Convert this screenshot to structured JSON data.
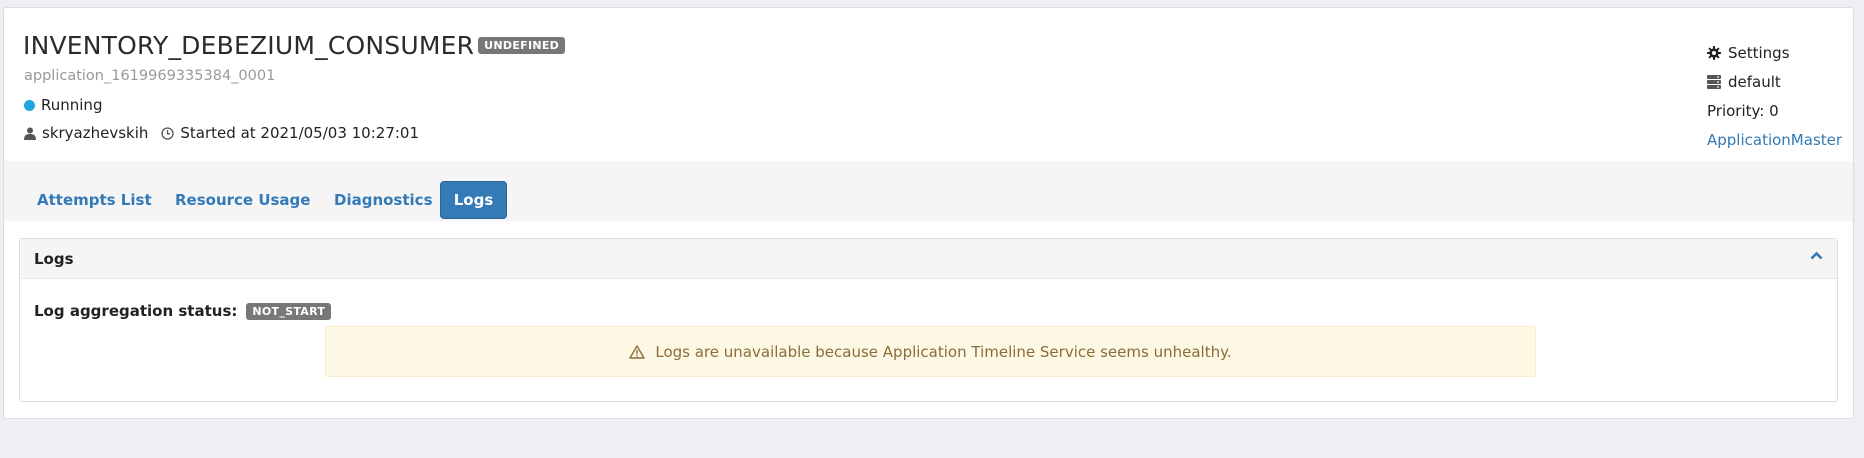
{
  "app": {
    "name": "INVENTORY_DEBEZIUM_CONSUMER",
    "final_status": "UNDEFINED",
    "id": "application_1619969335384_0001",
    "state": "Running",
    "state_color": "#1ea6dd",
    "user": "skryazhevskih",
    "started": "Started at 2021/05/03 10:27:01"
  },
  "sidebar_info": {
    "settings_label": "Settings",
    "queue": "default",
    "priority": "Priority: 0",
    "am_link": "ApplicationMaster"
  },
  "tabs": [
    {
      "label": "Attempts List",
      "active": false
    },
    {
      "label": "Resource Usage",
      "active": false
    },
    {
      "label": "Diagnostics",
      "active": false
    },
    {
      "label": "Logs",
      "active": true
    }
  ],
  "logs": {
    "heading": "Logs",
    "aggregation_label": "Log aggregation status:",
    "aggregation_status": "NOT_START",
    "alert_text": "Logs are unavailable because Application Timeline Service seems unhealthy."
  },
  "icons": {
    "settings": "gear-icon",
    "queue": "server-icon",
    "user": "user-icon",
    "clock": "clock-icon",
    "warning": "warning-icon",
    "collapse": "chevron-up-icon"
  },
  "colors": {
    "accent": "#337ab7",
    "alert_bg": "#fcf8e3",
    "alert_text": "#8a6d3b",
    "label_gray": "#777777"
  }
}
